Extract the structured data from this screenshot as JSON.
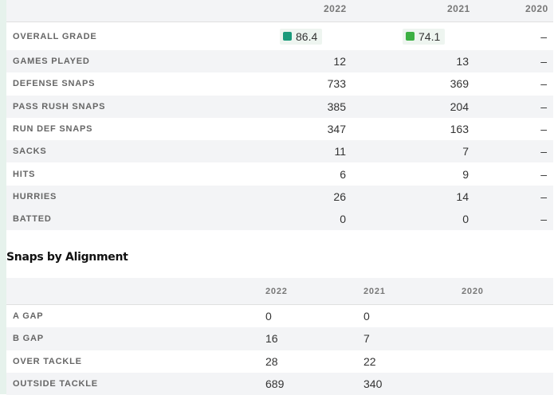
{
  "season_columns": [
    "2022",
    "2021",
    "2020"
  ],
  "overall_grade": {
    "label": "OVERALL GRADE",
    "values": [
      {
        "value": "86.4",
        "color": "#1a9a7a"
      },
      {
        "value": "74.1",
        "color": "#3cb043"
      },
      {
        "value": "–"
      }
    ]
  },
  "stat_rows": [
    {
      "label": "GAMES PLAYED",
      "values": [
        "12",
        "13",
        "–"
      ]
    },
    {
      "label": "DEFENSE SNAPS",
      "values": [
        "733",
        "369",
        "–"
      ]
    },
    {
      "label": "PASS RUSH SNAPS",
      "values": [
        "385",
        "204",
        "–"
      ]
    },
    {
      "label": "RUN DEF SNAPS",
      "values": [
        "347",
        "163",
        "–"
      ]
    },
    {
      "label": "SACKS",
      "values": [
        "11",
        "7",
        "–"
      ]
    },
    {
      "label": "HITS",
      "values": [
        "6",
        "9",
        "–"
      ]
    },
    {
      "label": "HURRIES",
      "values": [
        "26",
        "14",
        "–"
      ]
    },
    {
      "label": "BATTED",
      "values": [
        "0",
        "0",
        "–"
      ]
    }
  ],
  "alignment_section": {
    "title": "Snaps by Alignment",
    "columns": [
      "2022",
      "2021",
      "2020"
    ],
    "rows": [
      {
        "label": "A GAP",
        "values": [
          "0",
          "0",
          ""
        ]
      },
      {
        "label": "B GAP",
        "values": [
          "16",
          "7",
          ""
        ]
      },
      {
        "label": "OVER TACKLE",
        "values": [
          "28",
          "22",
          ""
        ]
      },
      {
        "label": "OUTSIDE TACKLE",
        "values": [
          "689",
          "340",
          ""
        ]
      }
    ]
  },
  "colors": {
    "accent_tab": "#2c7be5"
  }
}
